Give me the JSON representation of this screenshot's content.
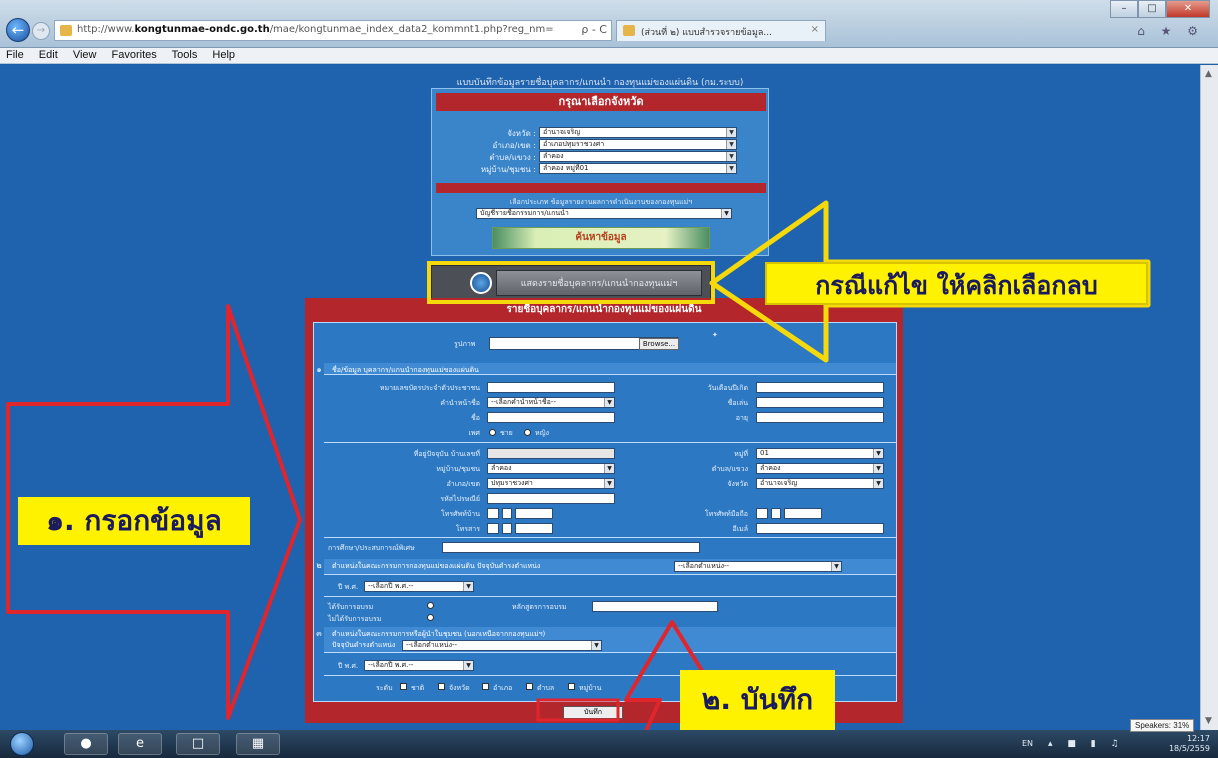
{
  "browser": {
    "url_prefix": "http://www.",
    "url_host": "kongtunmae-ondc.go.th",
    "url_path": "/mae/kongtunmae_index_data2_kommnt1.php?reg_nm=",
    "addr_tools": "ρ - C",
    "tab_title": "(ส่วนที่ ๒) แบบสำรวจรายข้อมูล...",
    "tab_close": "×",
    "win_min": "–",
    "win_max": "□",
    "win_close": "✕",
    "right_icons": "⌂ ★ ⚙",
    "menu": [
      "File",
      "Edit",
      "View",
      "Favorites",
      "Tools",
      "Help"
    ]
  },
  "page": {
    "heading": "แบบบันทึกข้อมูลรายชื่อบุคลากร/แกนนำ กองทุนแม่ของแผ่นดิน (กม.ระบบ)",
    "province_panel": {
      "title": "กรุณาเลือกจังหวัด",
      "fields": [
        {
          "label": "จังหวัด :",
          "value": "อำนาจเจริญ"
        },
        {
          "label": "อำเภอ/เขต :",
          "value": "อำเภอปทุมราชวงศา"
        },
        {
          "label": "ตำบล/แขวง :",
          "value": "ลำคอง"
        },
        {
          "label": "หมู่บ้าน/ชุมชน :",
          "value": "ลำคอง หมู่ที่01"
        }
      ],
      "note": "เลือกประเภท ข้อมูลรายงานผลการดำเนินงานของกองทุนแม่ฯ",
      "category_value": "บัญชีรายชื่อกรรมการ/แกนนำ",
      "search_label": "ค้นหาข้อมูล"
    },
    "show_button": "แสดงรายชื่อบุคลากร/แกนนำกองทุนแม่ฯ",
    "form": {
      "title": "รายชื่อบุคลากร/แกนนำกองทุนแม่ของแผ่นดิน",
      "photo_label": "รูปภาพ",
      "browse_label": "Browse...",
      "sec1_no": "๑",
      "sec1_title": "ชื่อ/ข้อมูล บุคลากร/แกนนำกองทุนแม่ของแผ่นดิน",
      "id_label": "หมายเลขบัตรประจำตัวประชาชน",
      "prefix_label": "คำนำหน้าชื่อ",
      "prefix_value": "--เลือกคำนำหน้าชื่อ--",
      "name_label": "ชื่อ",
      "gender_label": "เพศ",
      "gender_male": "ชาย",
      "gender_female": "หญิง",
      "birth_label": "วันเดือนปีเกิด",
      "nickname_label": "ชื่อเล่น",
      "age_label": "อายุ",
      "address_label": "ที่อยู่ปัจจุบัน บ้านเลขที่",
      "moo_label": "หมู่ที่",
      "moo_value": "01",
      "village_label": "หมู่บ้าน/ชุมชน",
      "village_value": "ลำคอง",
      "tambon_label": "ตำบล/แขวง",
      "tambon_value": "ลำคอง",
      "amphoe_label": "อำเภอ/เขต",
      "amphoe_value": "ปทุมราชวงศา",
      "province_label": "จังหวัด",
      "province_value": "อำนาจเจริญ",
      "postcode_label": "รหัสไปรษณีย์",
      "phone_label": "โทรศัพท์บ้าน",
      "mobile_label": "โทรศัพท์มือถือ",
      "fax_label": "โทรสาร",
      "email_label": "อีเมล์",
      "education_label": "การศึกษา/ประสบการณ์พิเศษ",
      "sec2_no": "๒",
      "sec2_title": "ตำแหน่งในคณะกรรมการกองทุนแม่ของแผ่นดิน ปัจจุบันดำรงตำแหน่ง",
      "sec2_value": "--เลือกตำแหน่ง--",
      "year_label": "ปี พ.ศ.",
      "year_value": "--เลือกปี พ.ศ.--",
      "trained_label": "ได้รับการอบรม",
      "not_trained_label": "ไม่ได้รับการอบรม",
      "course_label": "หลักสูตรการอบรม",
      "sec3_no": "๓",
      "sec3_title": "ตำแหน่งในคณะกรรมการหรือผู้นำในชุมชน (นอกเหนือจากกองทุนแม่ฯ)",
      "sec3_sub": "ปัจจุบันดำรงตำแหน่ง",
      "sec3_value": "--เลือกตำแหน่ง--",
      "year2_label": "ปี พ.ศ.",
      "year2_value": "--เลือกปี พ.ศ.--",
      "level_label": "ระดับ",
      "levels": [
        "ชาติ",
        "จังหวัด",
        "อำเภอ",
        "ตำบล",
        "หมู่บ้าน"
      ],
      "save_label": "บันทึก"
    }
  },
  "annotations": {
    "edit": "กรณีแก้ไข ให้คลิกเลือกลบ",
    "fill": "๑. กรอกข้อมูล",
    "save": "๒. บันทึก"
  },
  "taskbar": {
    "lang": "EN",
    "time": "12:17",
    "date": "18/5/2559",
    "speakers": "Speakers: 31%"
  }
}
